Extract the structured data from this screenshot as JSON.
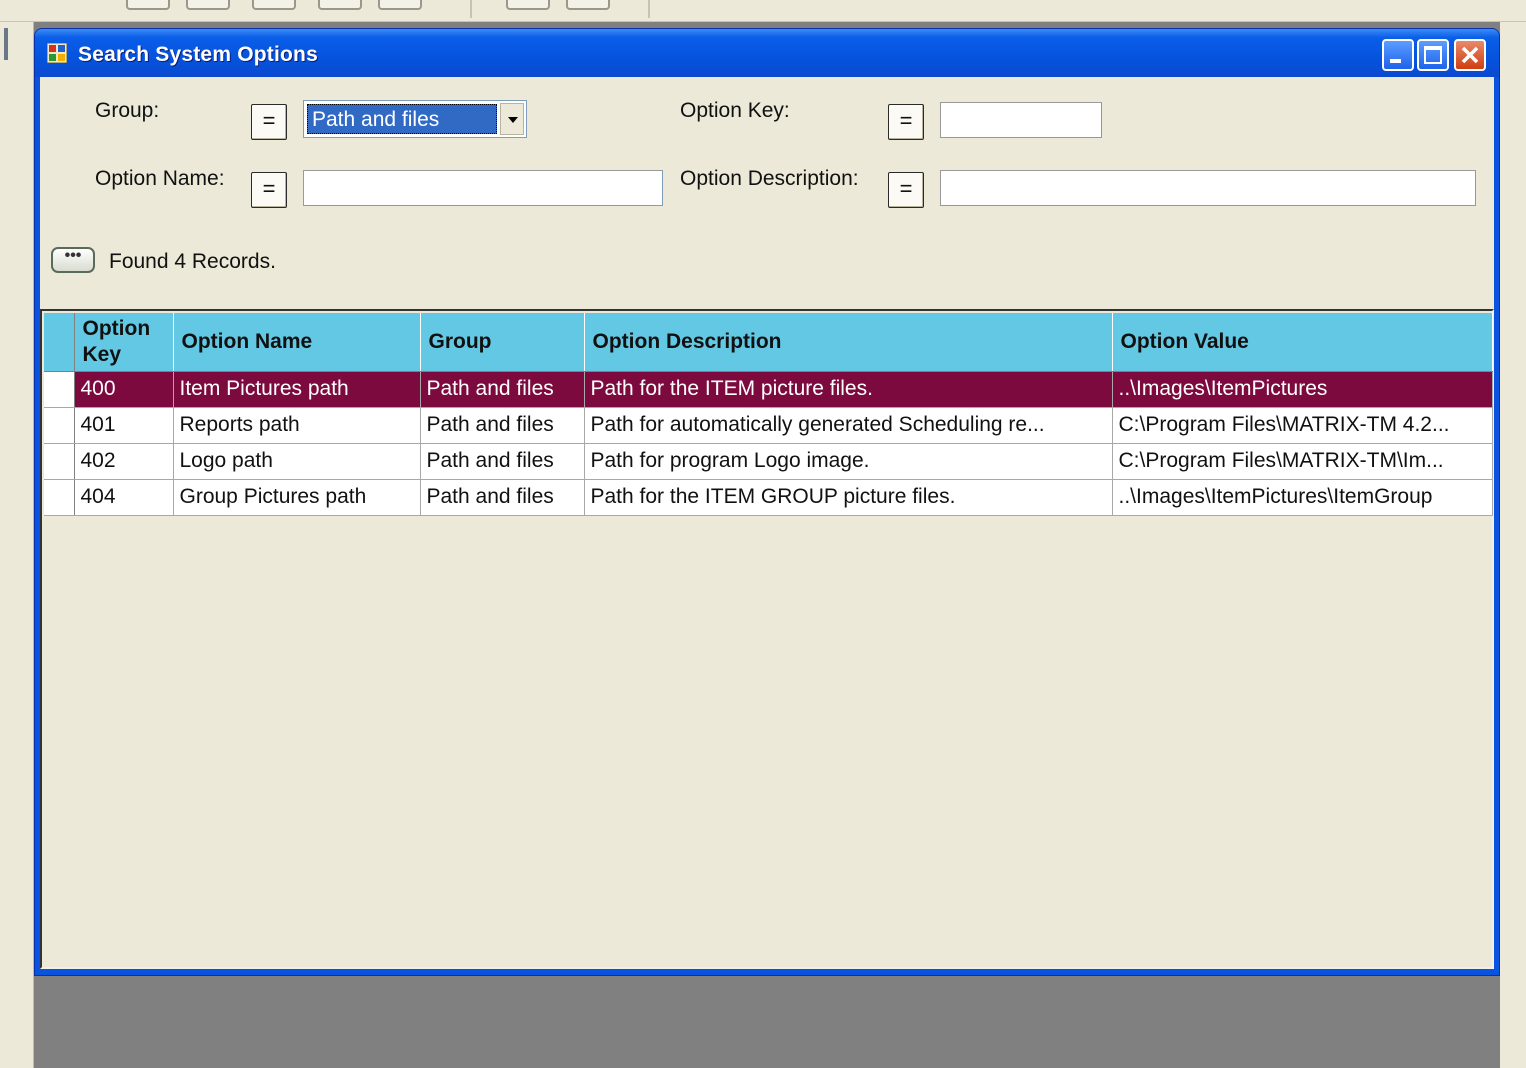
{
  "window": {
    "title": "Search System Options",
    "icon": "app-form-icon",
    "controls": [
      "minimize-icon",
      "maximize-icon",
      "close-icon"
    ]
  },
  "filters": {
    "group_label": "Group:",
    "group_operator": "=",
    "group_value": "Path and files",
    "option_key_label": "Option Key:",
    "option_key_operator": "=",
    "option_key_value": "",
    "option_name_label": "Option Name:",
    "option_name_operator": "=",
    "option_name_value": "",
    "option_description_label": "Option Description:",
    "option_description_operator": "=",
    "option_description_value": ""
  },
  "status": {
    "more_button_label": "•••",
    "found_text": "Found 4 Records."
  },
  "grid": {
    "columns": [
      "Option Key",
      "Option Name",
      "Group",
      "Option Description",
      "Option Value"
    ],
    "rows": [
      {
        "key": "400",
        "name": "Item Pictures path",
        "group": "Path and files",
        "description": "Path for the ITEM picture files.",
        "value": "..\\Images\\ItemPictures",
        "selected": true
      },
      {
        "key": "401",
        "name": "Reports path",
        "group": "Path and files",
        "description": "Path for automatically generated Scheduling re...",
        "value": "C:\\Program Files\\MATRIX-TM 4.2...",
        "selected": false
      },
      {
        "key": "402",
        "name": "Logo path",
        "group": "Path and files",
        "description": "Path for program Logo image.",
        "value": "C:\\Program Files\\MATRIX-TM\\Im...",
        "selected": false
      },
      {
        "key": "404",
        "name": "Group Pictures path",
        "group": "Path and files",
        "description": "Path for the ITEM GROUP picture files.",
        "value": "..\\Images\\ItemPictures\\ItemGroup",
        "selected": false
      }
    ]
  },
  "colors": {
    "title_bar": "#0a53e0",
    "header_bg": "#63c8e4",
    "selected_row": "#7d0a3e",
    "client_bg": "#ece9d8"
  }
}
